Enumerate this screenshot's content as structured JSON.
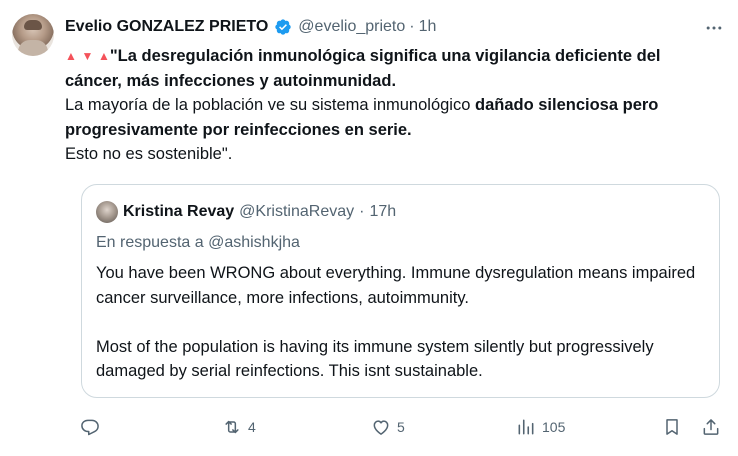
{
  "author": {
    "display_name": "Evelio GONZALEZ PRIETO",
    "handle": "@evelio_prieto",
    "separator": "·",
    "time": "1h",
    "avatar_icon": "user-photo"
  },
  "tweet": {
    "line1_bold": "\"La desregulación inmunológica significa una vigilancia deficiente del cáncer, más infecciones y autoinmunidad.",
    "line2_normal": "La mayoría de la población ve su sistema inmunológico ",
    "line2_bold": "dañado silenciosa pero progresivamente por reinfecciones en serie.",
    "line3": "Esto no es sostenible\".",
    "emoji_1": "▲",
    "emoji_2": "▼",
    "emoji_3": "▲"
  },
  "quote": {
    "display_name": "Kristina Revay",
    "handle": "@KristinaRevay",
    "separator": "·",
    "time": "17h",
    "reply_to": "En respuesta a @ashishkjha",
    "paragraph1": "You have been WRONG about everything.  Immune dysregulation means impaired cancer surveillance, more infections, autoimmunity.",
    "paragraph2": "Most of the population is having its immune system silently but progressively damaged by serial reinfections. This isnt sustainable."
  },
  "actions": {
    "reply_count": "",
    "retweet_count": "4",
    "like_count": "5",
    "views_count": "105"
  },
  "colors": {
    "text": "#0f1419",
    "secondary": "#536471",
    "verified": "#1d9bf0",
    "border": "#cfd9de",
    "emoji_red": "#f4525a"
  }
}
